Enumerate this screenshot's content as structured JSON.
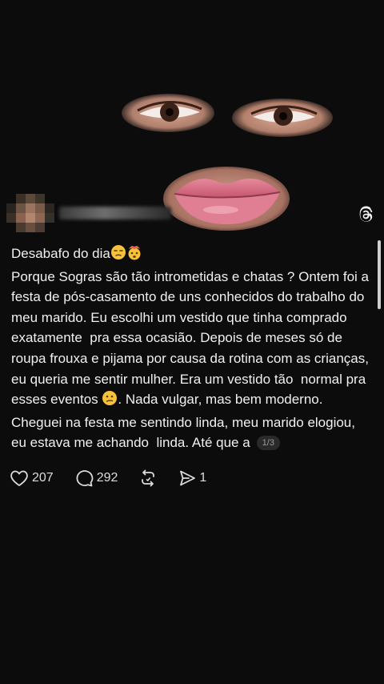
{
  "post": {
    "title": "Desabafo do dia",
    "title_emojis": [
      "unamused-face",
      "exploding-head"
    ],
    "body_line1": "Porque Sogras são tão intrometidas e chatas ? Ontem foi a festa de pós-casamento de uns conhecidos do trabalho do meu marido. Eu escolhi um vestido que tinha comprado exatamente  pra essa ocasião. Depois de meses só de roupa frouxa e pijama por causa da rotina com as crianças, eu queria me sentir mulher. Era um vestido tão  normal pra esses eventos ",
    "body_line2": ". Nada vulgar, mas bem moderno. Cheguei na festa me sentindo linda, meu marido elogiou, eu estava me achando  linda. Até que a",
    "inline_emoji": "confused-face",
    "page_indicator": "1/3"
  },
  "actions": {
    "likes": "207",
    "replies": "292",
    "shares": "1"
  },
  "icons": {
    "like": "heart-icon",
    "reply": "comment-bubble-icon",
    "repost": "repost-icon",
    "share": "send-icon",
    "app": "threads-logo-icon"
  },
  "colors": {
    "background": "#0c0c0c",
    "text": "#f0f0f0",
    "muted": "#9a9a9a"
  }
}
